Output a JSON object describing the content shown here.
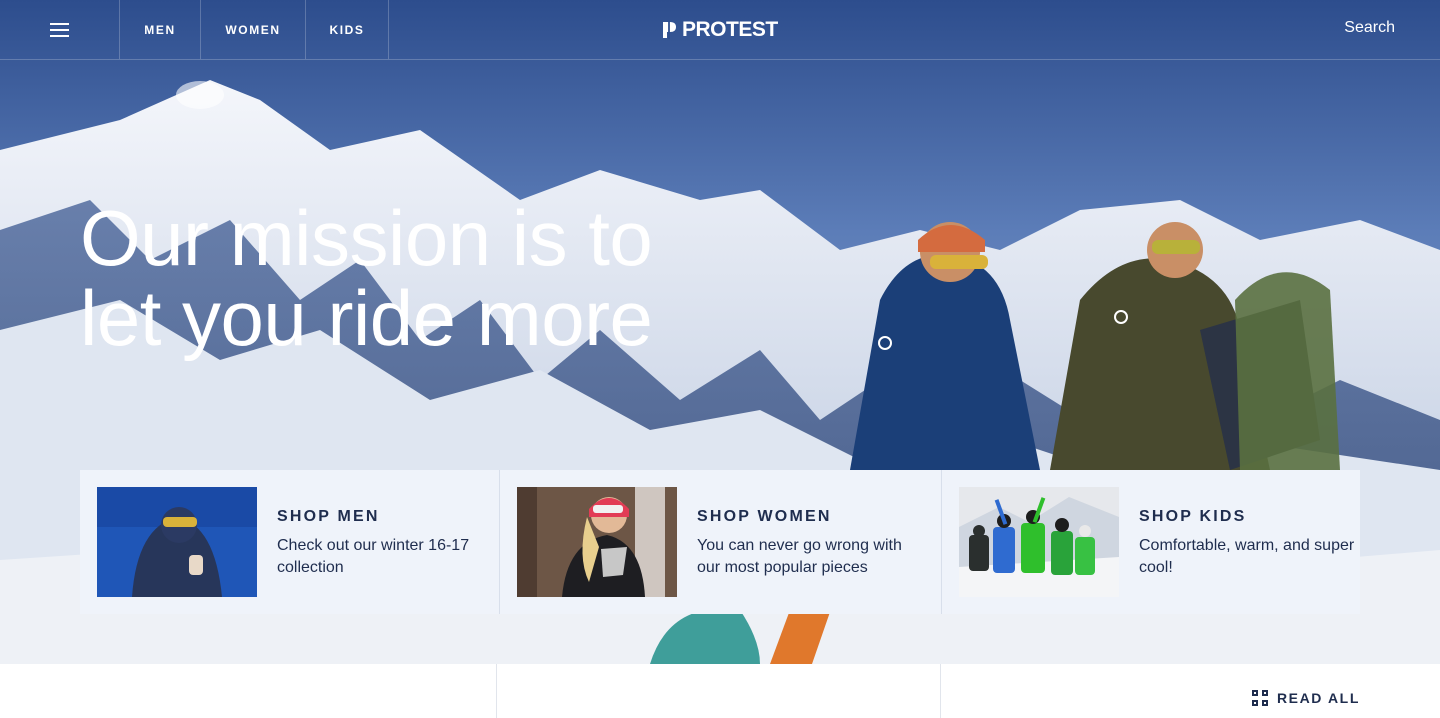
{
  "nav": {
    "items": [
      {
        "label": "MEN"
      },
      {
        "label": "WOMEN"
      },
      {
        "label": "KIDS"
      }
    ],
    "brand": "PROTEST",
    "search_label": "Search",
    "menu_icon": "hamburger-menu-icon"
  },
  "hero": {
    "headline": "Our mission is to let you ride more"
  },
  "shop_cards": [
    {
      "title": "SHOP MEN",
      "description": "Check out our winter 16-17 collection"
    },
    {
      "title": "SHOP WOMEN",
      "description": "You can never go wrong with our most popular pieces"
    },
    {
      "title": "SHOP KIDS",
      "description": "Comfortable, warm, and super cool!"
    }
  ],
  "footer": {
    "read_all_label": "READ ALL",
    "read_all_icon": "grid-icon"
  },
  "colors": {
    "navy": "#1f2d4e",
    "card_background": "#eff3fa",
    "sky": "#2f4f8f"
  }
}
